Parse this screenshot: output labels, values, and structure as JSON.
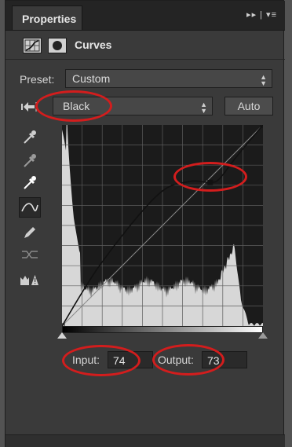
{
  "panel": {
    "tab_label": "Properties",
    "tab_controls": "▸▸ | ▾≡",
    "title": "Curves"
  },
  "preset": {
    "label": "Preset:",
    "value": "Custom"
  },
  "channel": {
    "value": "Black",
    "auto_label": "Auto"
  },
  "tools": [
    {
      "name": "sample-in-image-black-point-icon"
    },
    {
      "name": "sample-in-image-gray-point-icon"
    },
    {
      "name": "sample-in-image-white-point-icon"
    },
    {
      "name": "edit-points-curve-icon",
      "selected": true
    },
    {
      "name": "pencil-draw-curve-icon"
    },
    {
      "name": "smooth-curve-icon"
    },
    {
      "name": "clipping-warning-icon"
    }
  ],
  "io": {
    "input_label": "Input:",
    "input_value": "74",
    "output_label": "Output:",
    "output_value": "73"
  },
  "chart_data": {
    "type": "line",
    "series": [
      {
        "x": [
          0,
          50,
          120,
          160,
          188,
          200,
          220,
          255
        ],
        "y": [
          0,
          80,
          165,
          183,
          182,
          187,
          213,
          255
        ]
      }
    ],
    "xlim": [
      0,
      255
    ],
    "ylim": [
      0,
      255
    ],
    "selected_point": {
      "x": 188,
      "y": 182
    },
    "grid": true,
    "grid_divisions": 10
  },
  "colors": {
    "annotation": "#d31d1d",
    "panel_bg": "#3a3a3a",
    "graph_bg": "#1b1b1b",
    "histogram": "#d7d7d7"
  }
}
